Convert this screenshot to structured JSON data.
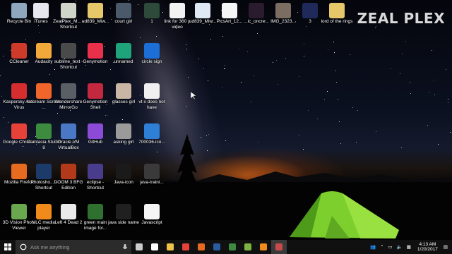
{
  "brand": "ZEAL PLEX",
  "desktop_icons": [
    {
      "label": "Recycle Bin",
      "icon": "recycle-bin-icon",
      "color": "#8fa6bf"
    },
    {
      "label": "iTunes",
      "icon": "itunes-icon",
      "color": "#e7e7f0"
    },
    {
      "label": "ZealPlex_M... - Shortcut",
      "icon": "shortcut-file-icon",
      "color": "#cfd6c9"
    },
    {
      "label": "ud839_Miw...",
      "icon": "folder-icon",
      "color": "#e6c76a"
    },
    {
      "label": "court girl",
      "icon": "photo-icon",
      "color": "#4a5a6a"
    },
    {
      "label": "1",
      "icon": "image-thumb-icon",
      "color": "#2d4a3a"
    },
    {
      "label": "link for 360 p video",
      "icon": "text-file-icon",
      "color": "#f2f2f2"
    },
    {
      "label": "ud839_Miw...",
      "icon": "window-thumb-icon",
      "color": "#dfe8f3"
    },
    {
      "label": "PicsArt_12...",
      "icon": "image-file-icon",
      "color": "#f5f5f5"
    },
    {
      "label": "...ic_oncre...",
      "icon": "video-thumb-icon",
      "color": "#2a1b2e"
    },
    {
      "label": "IMG_2323...",
      "icon": "photo-icon",
      "color": "#7b6d62"
    },
    {
      "label": "3",
      "icon": "image-thumb-icon",
      "color": "#1f2a5a"
    },
    {
      "label": "lord of the rings",
      "icon": "folder-icon",
      "color": "#e6c76a"
    },
    {
      "label": "CCleaner",
      "icon": "ccleaner-icon",
      "color": "#cf3b2a"
    },
    {
      "label": "Audacity",
      "icon": "audacity-icon",
      "color": "#f3a83a"
    },
    {
      "label": "sublime_text - Shortcut",
      "icon": "sublime-icon",
      "color": "#4a4a4a"
    },
    {
      "label": "Genymotion",
      "icon": "genymotion-icon",
      "color": "#e8304a"
    },
    {
      "label": "unnamed",
      "icon": "app-icon",
      "color": "#1fa37a"
    },
    {
      "label": "circle sign",
      "icon": "circle-sign-icon",
      "color": "#1d6fd8"
    },
    {
      "label": "Kaspersky Anti-Virus",
      "icon": "kaspersky-icon",
      "color": "#d62e2e"
    },
    {
      "label": "Icecream Screen ...",
      "icon": "icecream-icon",
      "color": "#f0662a"
    },
    {
      "label": "Wondershare MirrorGo",
      "icon": "mirrorgo-icon",
      "color": "#5a5f66"
    },
    {
      "label": "Genymotion Shell",
      "icon": "genymotion-shell-icon",
      "color": "#c4283e"
    },
    {
      "label": "glasses girl",
      "icon": "photo-icon",
      "color": "#c9b6a4"
    },
    {
      "label": "vt-x does not have",
      "icon": "image-file-icon",
      "color": "#f0f0f0"
    },
    {
      "label": "Google Chrome",
      "icon": "chrome-icon",
      "color": "#e6423a"
    },
    {
      "label": "Camtasia Studio 8",
      "icon": "camtasia-icon",
      "color": "#3c8b3f"
    },
    {
      "label": "Oracle VM VirtualBox",
      "icon": "virtualbox-icon",
      "color": "#4a78c4"
    },
    {
      "label": "GitHub",
      "icon": "github-icon",
      "color": "#8b4bd6"
    },
    {
      "label": "asking girl",
      "icon": "photo-icon",
      "color": "#9a9a9a"
    },
    {
      "label": "700036-ico...",
      "icon": "image-file-icon",
      "color": "#2e7fd6"
    },
    {
      "label": "Mozilla Firefox",
      "icon": "firefox-icon",
      "color": "#e66a1f"
    },
    {
      "label": "Photosho... - Shortcut",
      "icon": "photoshop-icon",
      "color": "#1c3b6a"
    },
    {
      "label": "DOOM 3 BFG Edition",
      "icon": "doom-icon",
      "color": "#b23a1a"
    },
    {
      "label": "eclipse - Shortcut",
      "icon": "eclipse-icon",
      "color": "#4a3c8c"
    },
    {
      "label": "Java-icon",
      "icon": "java-icon",
      "color": "#1a1a1a"
    },
    {
      "label": "java-traini...",
      "icon": "video-thumb-icon",
      "color": "#3a3a3a"
    },
    {
      "label": "3D Vision Photo Viewer",
      "icon": "3d-vision-icon",
      "color": "#6aa84f"
    },
    {
      "label": "VLC media player",
      "icon": "vlc-icon",
      "color": "#f08a1a"
    },
    {
      "label": "Left 4 Dead 2",
      "icon": "left4dead-icon",
      "color": "#eaeaea"
    },
    {
      "label": "green main image for...",
      "icon": "image-thumb-icon",
      "color": "#2f6f2f"
    },
    {
      "label": "java side name",
      "icon": "image-thumb-icon",
      "color": "#202020"
    },
    {
      "label": "Javascript",
      "icon": "javascript-file-icon",
      "color": "#f5f5f5"
    }
  ],
  "taskbar": {
    "search_placeholder": "Ask me anything",
    "apps": [
      {
        "icon": "task-view-icon"
      },
      {
        "icon": "store-icon"
      },
      {
        "icon": "file-explorer-icon"
      },
      {
        "icon": "chrome-icon"
      },
      {
        "icon": "firefox-icon"
      },
      {
        "icon": "photoshop-icon"
      },
      {
        "icon": "camtasia-icon"
      },
      {
        "icon": "android-icon"
      },
      {
        "icon": "vlc-icon"
      },
      {
        "icon": "snipping-tool-icon",
        "active": true
      }
    ],
    "clock_time": "4:13 AM",
    "clock_date": "1/20/2017"
  }
}
